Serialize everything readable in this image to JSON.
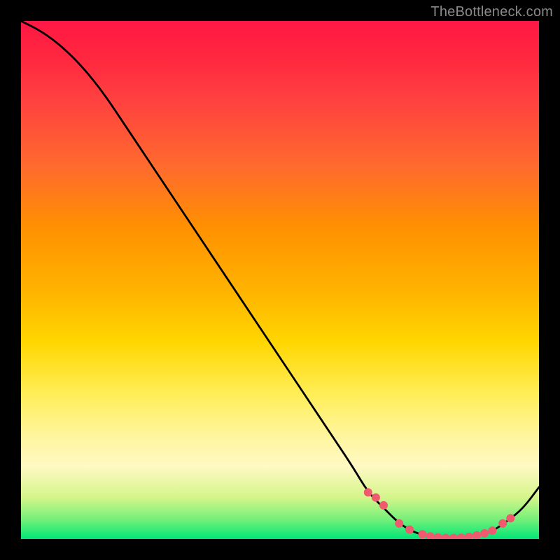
{
  "watermark": "TheBottleneck.com",
  "chart_data": {
    "type": "line",
    "title": "",
    "xlabel": "",
    "ylabel": "",
    "xlim": [
      0,
      100
    ],
    "ylim": [
      0,
      100
    ],
    "x": [
      0,
      4,
      8,
      12,
      16,
      20,
      24,
      28,
      32,
      36,
      40,
      44,
      48,
      52,
      56,
      60,
      64,
      67,
      70,
      73,
      76,
      79,
      82,
      85,
      88,
      91,
      94,
      97,
      100
    ],
    "values": [
      100,
      98,
      95,
      91,
      86,
      80,
      74,
      68,
      62,
      56,
      50,
      44,
      38,
      32,
      26,
      20,
      14,
      9,
      6,
      3,
      1.2,
      0.5,
      0.2,
      0.2,
      0.6,
      1.5,
      3.5,
      6,
      10
    ],
    "annotations_x": [
      67,
      68.5,
      70,
      73,
      75,
      77.5,
      79,
      80.5,
      82,
      83.5,
      85,
      86.5,
      88,
      89.5,
      91,
      93,
      94.5
    ],
    "annotations_y": [
      9,
      8,
      6.5,
      3,
      1.8,
      0.9,
      0.5,
      0.3,
      0.2,
      0.2,
      0.25,
      0.4,
      0.7,
      1.1,
      1.6,
      3,
      4
    ]
  }
}
